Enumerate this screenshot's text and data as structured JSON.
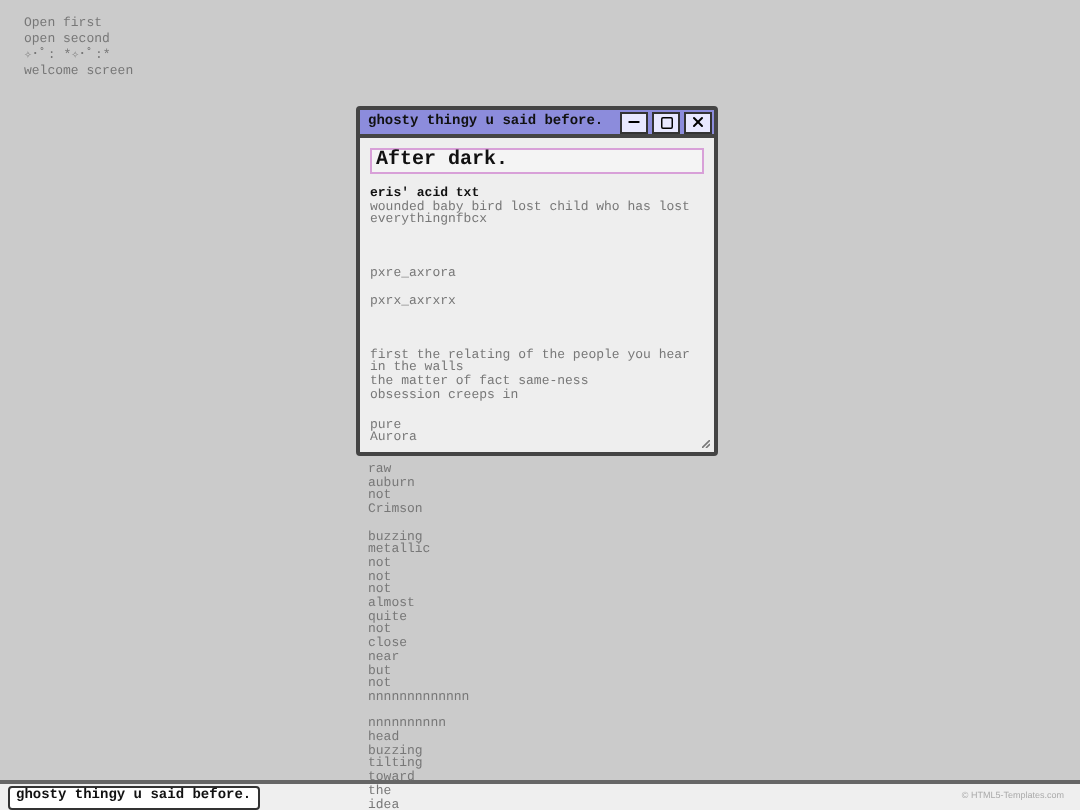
{
  "desktop_links": [
    "Open first",
    "open second",
    "✧･ﾟ: *✧･ﾟ:*",
    "welcome screen"
  ],
  "window": {
    "title": "ghosty thingy u said before.",
    "heading": "After dark.",
    "blocks": [
      {
        "kind": "bold",
        "text": "eris' acid txt"
      },
      {
        "kind": "text",
        "text": "wounded baby bird lost child who has lost everythingnfbcx"
      },
      {
        "kind": "gap"
      },
      {
        "kind": "text",
        "text": "pxre_axrora"
      },
      {
        "kind": "space"
      },
      {
        "kind": "text",
        "text": "pxrx_axrxrx"
      },
      {
        "kind": "gap"
      },
      {
        "kind": "text",
        "text": "first the relating of the people you hear in the walls"
      },
      {
        "kind": "text",
        "text": "the matter of fact same-ness"
      },
      {
        "kind": "text",
        "text": "obsession creeps in"
      },
      {
        "kind": "bottom"
      },
      {
        "kind": "text",
        "text": "pure"
      },
      {
        "kind": "text",
        "text": "Aurora"
      }
    ]
  },
  "overflow_groups": [
    [
      "raw",
      "auburn",
      "not",
      "Crimson"
    ],
    [
      "buzzing",
      "metallic",
      "not",
      "not",
      "not",
      "almost",
      "quite",
      "not",
      "close",
      "near",
      "but",
      "not",
      "nnnnnnnnnnnnn"
    ],
    [
      "nnnnnnnnnn",
      "head",
      "buzzing",
      "tilting",
      "toward",
      "the",
      "idea"
    ]
  ],
  "taskbar": {
    "button": "ghosty thingy u said before.",
    "credit": "© HTML5-Templates.com"
  }
}
